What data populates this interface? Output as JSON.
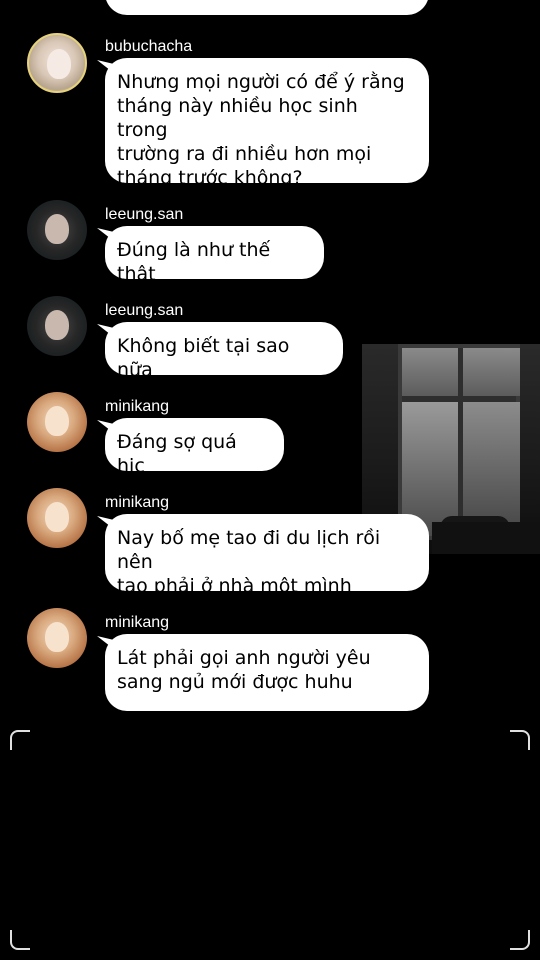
{
  "messages": [
    {
      "username": "bubuchacha",
      "avatar": "bubuchacha-avatar",
      "lines": [
        "Nhưng mọi người có để ý rằng",
        "tháng này nhiều học sinh trong",
        "trường ra đi nhiều hơn mọi",
        "tháng trước không?"
      ]
    },
    {
      "username": "leeung.san",
      "avatar": "leeung-avatar",
      "lines": [
        "Đúng là như thế thật"
      ]
    },
    {
      "username": "leeung.san",
      "avatar": "leeung-avatar",
      "lines": [
        "Không biết tại sao nữa"
      ]
    },
    {
      "username": "minikang",
      "avatar": "minikang-avatar",
      "lines": [
        "Đáng sợ quá hic"
      ]
    },
    {
      "username": "minikang",
      "avatar": "minikang-avatar",
      "lines": [
        "Nay bố mẹ tao đi du lịch rồi nên",
        "tao phải ở nhà một mình"
      ]
    },
    {
      "username": "minikang",
      "avatar": "minikang-avatar",
      "lines": [
        "Lát phải gọi anh người yêu",
        "sang ngủ mới được huhu"
      ]
    }
  ],
  "colors": {
    "background": "#000000",
    "bubble": "#ffffff",
    "username": "#ffffff"
  }
}
